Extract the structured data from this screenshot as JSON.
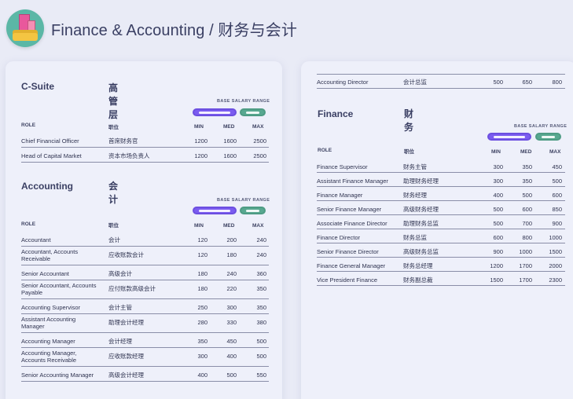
{
  "header": {
    "title": "Finance & Accounting / 财务与会计"
  },
  "left": {
    "csuite": {
      "title_en": "C-Suite",
      "title_zh": "高管层",
      "range_label": "BASE SALARY RANGE",
      "cols": [
        "ROLE",
        "职位",
        "MIN",
        "MED",
        "MAX"
      ],
      "rows": [
        {
          "role": "Chief Financial Officer",
          "zh": "首席财务官",
          "min": "1200",
          "med": "1600",
          "max": "2500"
        },
        {
          "role": "Head of Capital Market",
          "zh": "资本市场负责人",
          "min": "1200",
          "med": "1600",
          "max": "2500"
        }
      ]
    },
    "accounting": {
      "title_en": "Accounting",
      "title_zh": "会计",
      "range_label": "BASE SALARY RANGE",
      "cols": [
        "ROLE",
        "职位",
        "MIN",
        "MED",
        "MAX"
      ],
      "rows": [
        {
          "role": "Accountant",
          "zh": "会计",
          "min": "120",
          "med": "200",
          "max": "240"
        },
        {
          "role": "Accountant, Accounts Receivable",
          "zh": "应收账款会计",
          "min": "120",
          "med": "180",
          "max": "240"
        },
        {
          "role": "Senior Accountant",
          "zh": "高级会计",
          "min": "180",
          "med": "240",
          "max": "360"
        },
        {
          "role": "Senior Accountant, Accounts Payable",
          "zh": "应付账款高级会计",
          "min": "180",
          "med": "220",
          "max": "350"
        },
        {
          "role": "Accounting Supervisor",
          "zh": "会计主管",
          "min": "250",
          "med": "300",
          "max": "350"
        },
        {
          "role": "Assistant Accounting Manager",
          "zh": "助理会计经理",
          "min": "280",
          "med": "330",
          "max": "380"
        },
        {
          "role": "Accounting Manager",
          "zh": "会计经理",
          "min": "350",
          "med": "450",
          "max": "500"
        },
        {
          "role": "Accounting Manager, Accounts Receivable",
          "zh": "应收账款经理",
          "min": "300",
          "med": "400",
          "max": "500"
        },
        {
          "role": "Senior Accounting Manager",
          "zh": "高级会计经理",
          "min": "400",
          "med": "500",
          "max": "550"
        }
      ]
    }
  },
  "right": {
    "top_row": {
      "role": "Accounting Director",
      "zh": "会计总监",
      "min": "500",
      "med": "650",
      "max": "800"
    },
    "finance": {
      "title_en": "Finance",
      "title_zh": "财务",
      "range_label": "BASE SALARY RANGE",
      "cols": [
        "ROLE",
        "职位",
        "MIN",
        "MED",
        "MAX"
      ],
      "rows": [
        {
          "role": "Finance Supervisor",
          "zh": "财务主管",
          "min": "300",
          "med": "350",
          "max": "450"
        },
        {
          "role": "Assistant Finance Manager",
          "zh": "助理财务经理",
          "min": "300",
          "med": "350",
          "max": "500"
        },
        {
          "role": "Finance Manager",
          "zh": "财务经理",
          "min": "400",
          "med": "500",
          "max": "600"
        },
        {
          "role": "Senior Finance Manager",
          "zh": "高级财务经理",
          "min": "500",
          "med": "600",
          "max": "850"
        },
        {
          "role": "Associate Finance Director",
          "zh": "助理财务总监",
          "min": "500",
          "med": "700",
          "max": "900"
        },
        {
          "role": "Finance Director",
          "zh": "财务总监",
          "min": "600",
          "med": "800",
          "max": "1000"
        },
        {
          "role": "Senior Finance Director",
          "zh": "高级财务总监",
          "min": "900",
          "med": "1000",
          "max": "1500"
        },
        {
          "role": "Finance General Manager",
          "zh": "财务总经理",
          "min": "1200",
          "med": "1700",
          "max": "2000"
        },
        {
          "role": "Vice President Finance",
          "zh": "财务副总裁",
          "min": "1500",
          "med": "1700",
          "max": "2300"
        }
      ]
    }
  }
}
